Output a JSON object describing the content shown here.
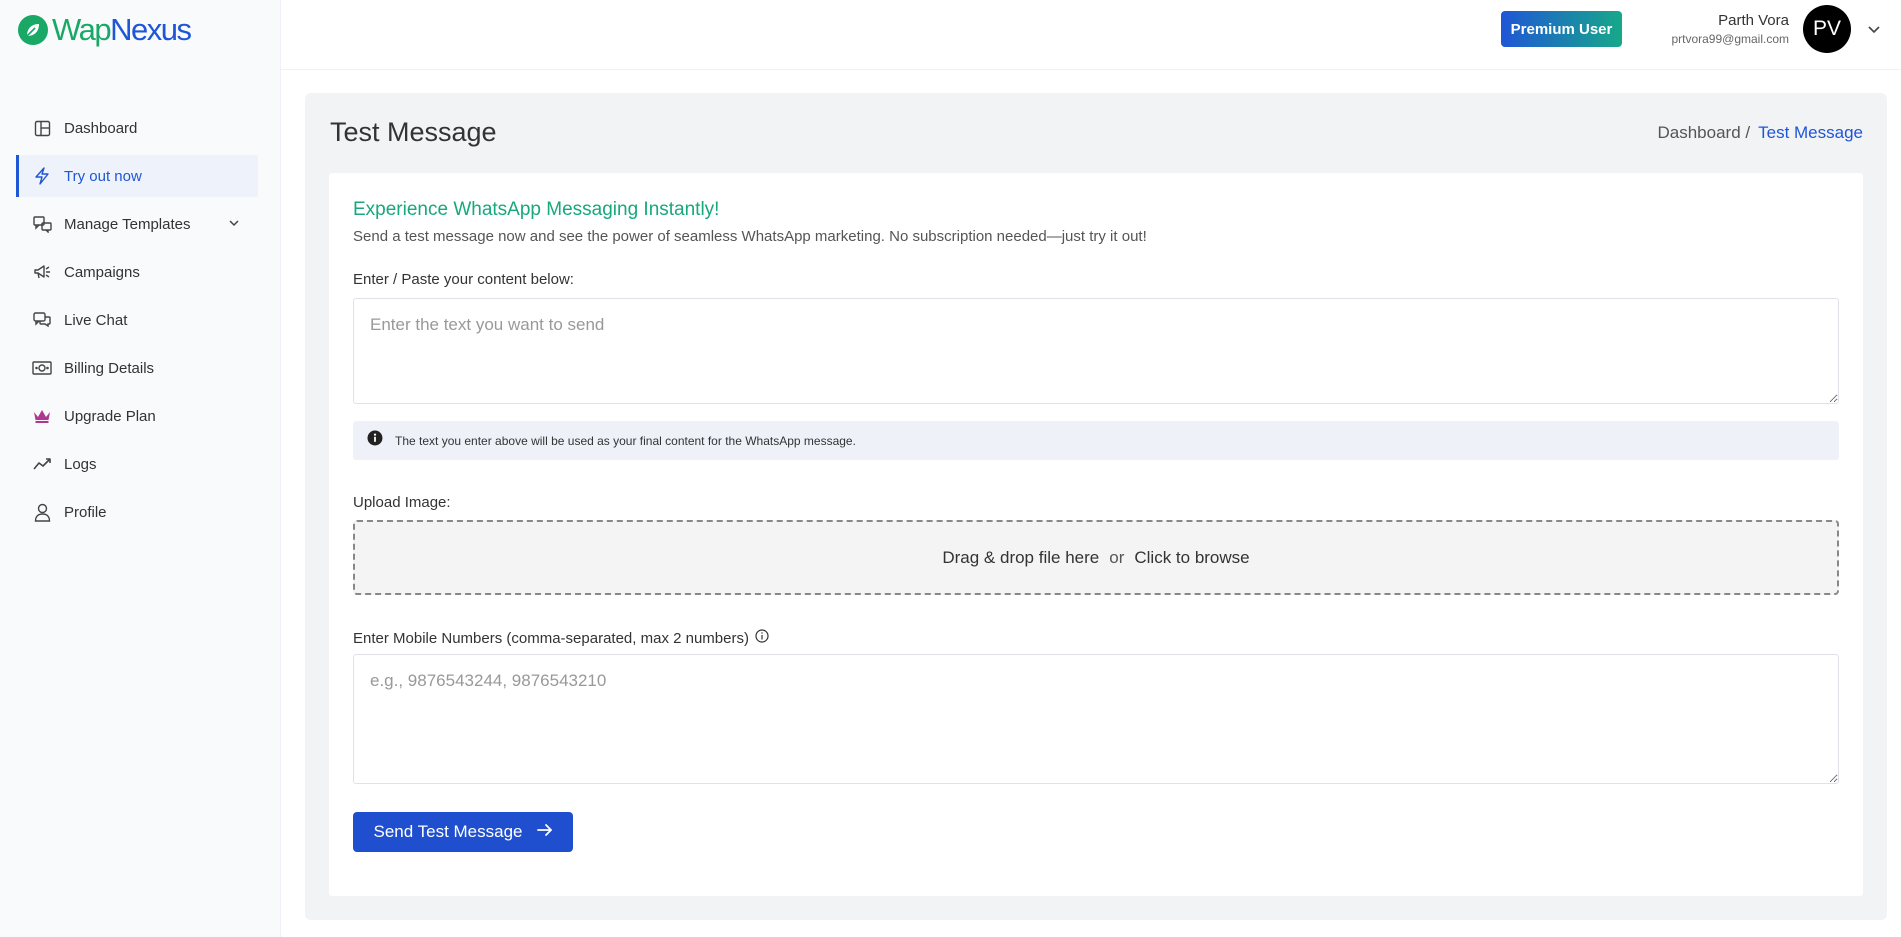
{
  "brand": {
    "part1": "Wap",
    "part2": "Nexus"
  },
  "sidebar": {
    "items": [
      {
        "label": "Dashboard",
        "icon": "dashboard-icon"
      },
      {
        "label": "Try out now",
        "icon": "lightning-icon",
        "active": true
      },
      {
        "label": "Manage Templates",
        "icon": "templates-icon",
        "has_submenu": true
      },
      {
        "label": "Campaigns",
        "icon": "megaphone-icon"
      },
      {
        "label": "Live Chat",
        "icon": "chat-icon"
      },
      {
        "label": "Billing Details",
        "icon": "money-icon"
      },
      {
        "label": "Upgrade Plan",
        "icon": "crown-icon"
      },
      {
        "label": "Logs",
        "icon": "trend-icon"
      },
      {
        "label": "Profile",
        "icon": "user-icon"
      }
    ]
  },
  "header": {
    "premium_label": "Premium User",
    "user_name": "Parth Vora",
    "user_email": "prtvora99@gmail.com",
    "avatar_initials": "PV"
  },
  "page": {
    "title": "Test Message",
    "breadcrumb": {
      "home": "Dashboard /",
      "current": "Test Message"
    }
  },
  "card": {
    "heading": "Experience WhatsApp Messaging Instantly!",
    "subheading": "Send a test message now and see the power of seamless WhatsApp marketing. No subscription needed—just try it out!",
    "content_label": "Enter / Paste your content below:",
    "content_placeholder": "Enter the text you want to send",
    "content_value": "",
    "info_text": "The text you enter above will be used as your final content for the WhatsApp message.",
    "upload_label": "Upload Image:",
    "drop_text": "Drag & drop file here",
    "drop_or": "or",
    "drop_browse": "Click to browse",
    "mobile_label": "Enter Mobile Numbers (comma-separated, max 2 numbers)",
    "mobile_placeholder": "e.g., 9876543244, 9876543210",
    "mobile_value": "",
    "send_label": "Send Test Message"
  },
  "colors": {
    "primary": "#1f56d6",
    "green": "#17a87c",
    "crown": "#b0378f"
  }
}
